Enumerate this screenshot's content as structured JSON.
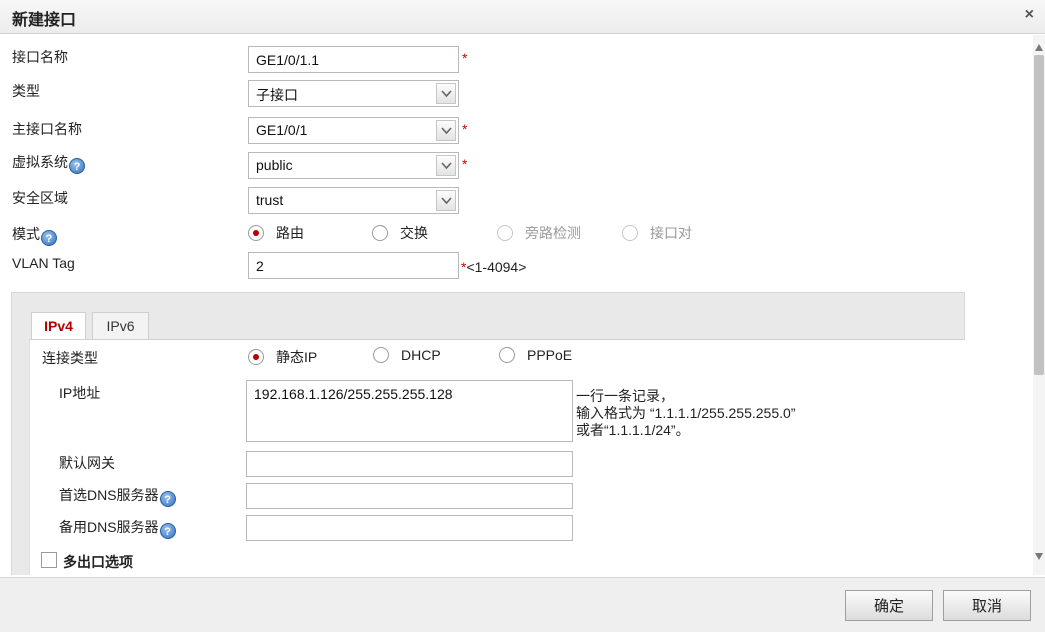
{
  "dialog": {
    "title": "新建接口",
    "close_glyph": "×"
  },
  "form": {
    "interface_name": {
      "label": "接口名称",
      "value": "GE1/0/1.1",
      "required": "*"
    },
    "type": {
      "label": "类型",
      "value": "子接口"
    },
    "parent_interface": {
      "label": "主接口名称",
      "value": "GE1/0/1",
      "required": "*"
    },
    "virtual_system": {
      "label": "虚拟系统",
      "value": "public",
      "required": "*"
    },
    "security_zone": {
      "label": "安全区域",
      "value": "trust"
    },
    "mode": {
      "label": "模式",
      "options": [
        "路由",
        "交换",
        "旁路检测",
        "接口对"
      ],
      "selected": "路由"
    },
    "vlan_tag": {
      "label": "VLAN Tag",
      "value": "2",
      "hint": "*<1-4094>"
    }
  },
  "tabs": [
    {
      "label": "IPv4",
      "active": true
    },
    {
      "label": "IPv6",
      "active": false
    }
  ],
  "ipv4": {
    "connection_type": {
      "label": "连接类型",
      "options": [
        "静态IP",
        "DHCP",
        "PPPoE"
      ],
      "selected": "静态IP"
    },
    "ip_address": {
      "label": "IP地址",
      "value": "192.168.1.126/255.255.255.128",
      "hint_lines": [
        "一行一条记录，",
        "输入格式为 “1.1.1.1/255.255.255.0”",
        "或者“1.1.1.1/24”。"
      ]
    },
    "default_gateway": {
      "label": "默认网关",
      "value": ""
    },
    "primary_dns": {
      "label": "首选DNS服务器",
      "value": ""
    },
    "secondary_dns": {
      "label": "备用DNS服务器",
      "value": ""
    },
    "multi_egress": {
      "label": "多出口选项"
    }
  },
  "help_glyph": "?",
  "footer": {
    "ok_label": "确定",
    "cancel_label": "取消"
  },
  "colors": {
    "accent": "#b30000",
    "required": "#d40000",
    "help_blue": "#2f6fba"
  }
}
